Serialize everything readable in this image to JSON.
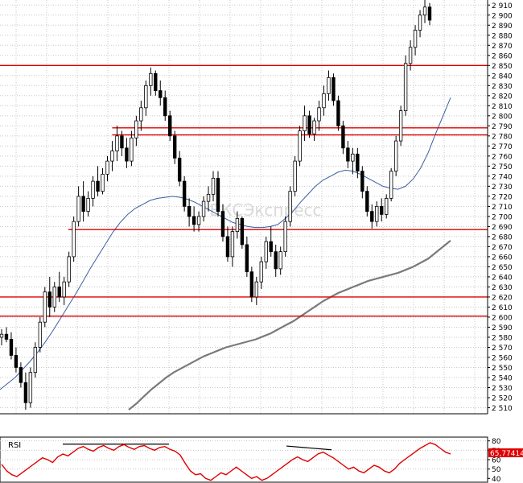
{
  "colors": {
    "background": "#ffffff",
    "grid": "#c8c8c8",
    "candle": "#000000",
    "ma_short": "#3a5fa0",
    "ma_long": "#7a7a7a",
    "level_line": "#e00000",
    "rsi_line": "#e00000",
    "rsi_line_alt": "#3a3aa0",
    "rsi_label_bg": "#e00000"
  },
  "watermark": "БКСЭкспресс",
  "chart_data": [
    {
      "type": "candlestick",
      "title": "",
      "y_ticks": [
        2510,
        2520,
        2530,
        2540,
        2550,
        2560,
        2570,
        2580,
        2590,
        2600,
        2610,
        2620,
        2630,
        2640,
        2650,
        2660,
        2670,
        2680,
        2690,
        2700,
        2710,
        2720,
        2730,
        2740,
        2750,
        2760,
        2770,
        2780,
        2790,
        2800,
        2810,
        2820,
        2830,
        2840,
        2850,
        2860,
        2870,
        2880,
        2890,
        2900,
        2910
      ],
      "y_tick_labels": [
        "2 510",
        "2 520",
        "2 530",
        "2 540",
        "2 550",
        "2 560",
        "2 570",
        "2 580",
        "2 590",
        "2 600",
        "2 610",
        "2 620",
        "2 630",
        "2 640",
        "2 650",
        "2 660",
        "2 670",
        "2 680",
        "2 690",
        "2 700",
        "2 710",
        "2 720",
        "2 730",
        "2 740",
        "2 750",
        "2 760",
        "2 770",
        "2 780",
        "2 790",
        "2 800",
        "2 810",
        "2 820",
        "2 830",
        "2 840",
        "2 850",
        "2 860",
        "2 870",
        "2 880",
        "2 890",
        "2 900",
        "2 910"
      ],
      "ylim": [
        2504,
        2915
      ],
      "grid": true,
      "horizontal_levels": [
        {
          "y": 2850,
          "x_from": 0,
          "x_to": 1
        },
        {
          "y": 2788,
          "x_from": 0.23,
          "x_to": 1
        },
        {
          "y": 2781,
          "x_from": 0.23,
          "x_to": 1
        },
        {
          "y": 2687,
          "x_from": 0.14,
          "x_to": 1
        },
        {
          "y": 2620,
          "x_from": 0,
          "x_to": 1
        },
        {
          "y": 2601,
          "x_from": 0,
          "x_to": 1
        }
      ],
      "candles": [
        [
          2580,
          2588,
          2572,
          2583
        ],
        [
          2583,
          2590,
          2575,
          2578
        ],
        [
          2578,
          2585,
          2558,
          2562
        ],
        [
          2562,
          2570,
          2545,
          2550
        ],
        [
          2550,
          2555,
          2530,
          2535
        ],
        [
          2535,
          2545,
          2508,
          2515
        ],
        [
          2515,
          2550,
          2510,
          2545
        ],
        [
          2545,
          2575,
          2540,
          2570
        ],
        [
          2570,
          2600,
          2565,
          2595
        ],
        [
          2595,
          2630,
          2590,
          2625
        ],
        [
          2625,
          2640,
          2600,
          2610
        ],
        [
          2610,
          2635,
          2605,
          2630
        ],
        [
          2630,
          2645,
          2615,
          2620
        ],
        [
          2620,
          2640,
          2612,
          2635
        ],
        [
          2635,
          2665,
          2630,
          2660
        ],
        [
          2660,
          2700,
          2655,
          2695
        ],
        [
          2695,
          2730,
          2690,
          2720
        ],
        [
          2720,
          2735,
          2695,
          2705
        ],
        [
          2705,
          2725,
          2700,
          2718
        ],
        [
          2718,
          2740,
          2710,
          2735
        ],
        [
          2735,
          2750,
          2720,
          2725
        ],
        [
          2725,
          2748,
          2722,
          2742
        ],
        [
          2742,
          2760,
          2735,
          2755
        ],
        [
          2755,
          2775,
          2745,
          2765
        ],
        [
          2765,
          2790,
          2755,
          2780
        ],
        [
          2780,
          2785,
          2760,
          2768
        ],
        [
          2768,
          2778,
          2748,
          2755
        ],
        [
          2755,
          2785,
          2750,
          2778
        ],
        [
          2778,
          2800,
          2770,
          2795
        ],
        [
          2795,
          2815,
          2785,
          2808
        ],
        [
          2808,
          2835,
          2800,
          2830
        ],
        [
          2830,
          2848,
          2820,
          2842
        ],
        [
          2842,
          2845,
          2820,
          2825
        ],
        [
          2825,
          2835,
          2810,
          2818
        ],
        [
          2818,
          2825,
          2795,
          2800
        ],
        [
          2800,
          2805,
          2775,
          2780
        ],
        [
          2780,
          2785,
          2752,
          2758
        ],
        [
          2758,
          2765,
          2730,
          2735
        ],
        [
          2735,
          2740,
          2705,
          2710
        ],
        [
          2710,
          2718,
          2690,
          2700
        ],
        [
          2700,
          2710,
          2685,
          2692
        ],
        [
          2692,
          2705,
          2685,
          2700
        ],
        [
          2700,
          2720,
          2695,
          2715
        ],
        [
          2715,
          2730,
          2705,
          2722
        ],
        [
          2722,
          2745,
          2715,
          2738
        ],
        [
          2738,
          2745,
          2700,
          2705
        ],
        [
          2705,
          2712,
          2675,
          2680
        ],
        [
          2680,
          2690,
          2655,
          2660
        ],
        [
          2660,
          2690,
          2650,
          2685
        ],
        [
          2685,
          2705,
          2678,
          2698
        ],
        [
          2698,
          2700,
          2668,
          2672
        ],
        [
          2672,
          2680,
          2640,
          2645
        ],
        [
          2645,
          2650,
          2615,
          2620
        ],
        [
          2620,
          2640,
          2612,
          2635
        ],
        [
          2635,
          2660,
          2628,
          2655
        ],
        [
          2655,
          2680,
          2648,
          2675
        ],
        [
          2675,
          2690,
          2660,
          2665
        ],
        [
          2665,
          2672,
          2640,
          2648
        ],
        [
          2648,
          2670,
          2642,
          2665
        ],
        [
          2665,
          2700,
          2660,
          2695
        ],
        [
          2695,
          2730,
          2690,
          2725
        ],
        [
          2725,
          2760,
          2720,
          2755
        ],
        [
          2755,
          2790,
          2750,
          2785
        ],
        [
          2785,
          2810,
          2775,
          2800
        ],
        [
          2800,
          2805,
          2778,
          2782
        ],
        [
          2782,
          2798,
          2775,
          2795
        ],
        [
          2795,
          2815,
          2785,
          2808
        ],
        [
          2808,
          2830,
          2800,
          2822
        ],
        [
          2822,
          2845,
          2815,
          2838
        ],
        [
          2838,
          2842,
          2810,
          2815
        ],
        [
          2815,
          2820,
          2785,
          2790
        ],
        [
          2790,
          2795,
          2762,
          2768
        ],
        [
          2768,
          2775,
          2748,
          2755
        ],
        [
          2755,
          2768,
          2742,
          2762
        ],
        [
          2762,
          2768,
          2738,
          2745
        ],
        [
          2745,
          2750,
          2718,
          2725
        ],
        [
          2725,
          2730,
          2700,
          2705
        ],
        [
          2705,
          2712,
          2688,
          2695
        ],
        [
          2695,
          2715,
          2690,
          2710
        ],
        [
          2710,
          2718,
          2695,
          2702
        ],
        [
          2702,
          2722,
          2698,
          2718
        ],
        [
          2718,
          2748,
          2715,
          2745
        ],
        [
          2745,
          2780,
          2740,
          2775
        ],
        [
          2775,
          2810,
          2770,
          2805
        ],
        [
          2805,
          2860,
          2800,
          2852
        ],
        [
          2852,
          2875,
          2845,
          2868
        ],
        [
          2868,
          2890,
          2860,
          2885
        ],
        [
          2885,
          2905,
          2878,
          2900
        ],
        [
          2900,
          2915,
          2892,
          2908
        ],
        [
          2908,
          2912,
          2890,
          2895
        ]
      ],
      "ma_short": [
        2528,
        2534,
        2540,
        2548,
        2556,
        2565,
        2575,
        2586,
        2598,
        2610,
        2622,
        2635,
        2648,
        2660,
        2672,
        2684,
        2694,
        2702,
        2708,
        2712,
        2716,
        2718,
        2719,
        2720,
        2719,
        2717,
        2714,
        2710,
        2706,
        2702,
        2698,
        2694,
        2692,
        2690,
        2689,
        2689,
        2690,
        2692,
        2698,
        2705,
        2714,
        2722,
        2730,
        2736,
        2740,
        2744,
        2746,
        2745,
        2742,
        2738,
        2734,
        2730,
        2728,
        2727,
        2730,
        2737,
        2748,
        2763,
        2782,
        2800,
        2818
      ],
      "ma_long": [
        2508,
        2514,
        2521,
        2528,
        2534,
        2540,
        2545,
        2549,
        2553,
        2557,
        2561,
        2564,
        2567,
        2570,
        2572,
        2574,
        2576,
        2578,
        2581,
        2584,
        2588,
        2592,
        2596,
        2601,
        2606,
        2611,
        2616,
        2620,
        2624,
        2627,
        2630,
        2633,
        2636,
        2638,
        2640,
        2642,
        2644,
        2647,
        2650,
        2654,
        2658,
        2664,
        2670,
        2676
      ]
    },
    {
      "type": "line",
      "title": "RSI",
      "y_ticks": [
        40,
        50,
        60,
        70,
        80
      ],
      "ylim": [
        36,
        84
      ],
      "reference_levels": [
        80,
        70,
        60,
        50
      ],
      "last_value": "65,77414",
      "values": [
        55,
        48,
        44,
        42,
        46,
        50,
        54,
        58,
        62,
        60,
        57,
        63,
        66,
        64,
        68,
        72,
        74,
        71,
        69,
        73,
        75,
        72,
        70,
        74,
        76,
        73,
        71,
        74,
        75,
        72,
        70,
        73,
        74,
        71,
        69,
        65,
        56,
        48,
        44,
        45,
        40,
        38,
        42,
        46,
        44,
        48,
        52,
        48,
        44,
        40,
        42,
        38,
        40,
        44,
        48,
        52,
        56,
        60,
        63,
        60,
        58,
        62,
        66,
        68,
        65,
        62,
        58,
        54,
        50,
        52,
        48,
        46,
        50,
        54,
        52,
        48,
        46,
        50,
        56,
        60,
        64,
        68,
        72,
        75,
        78,
        76,
        72,
        68,
        66
      ]
    }
  ]
}
